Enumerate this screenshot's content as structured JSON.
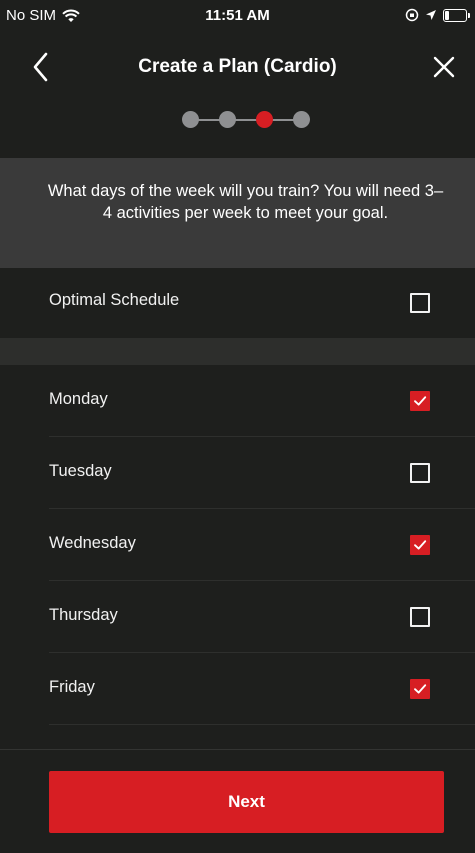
{
  "status_bar": {
    "carrier": "No SIM",
    "time": "11:51 AM"
  },
  "nav": {
    "title": "Create a Plan (Cardio)",
    "back_icon": "chevron-left-icon",
    "close_icon": "close-icon"
  },
  "stepper": {
    "total_steps": 4,
    "current_step": 3
  },
  "banner": {
    "text": "What days of the week will you train? You will need 3–4 activities per week to meet your goal."
  },
  "optimal": {
    "label": "Optimal Schedule",
    "checked": false
  },
  "days": [
    {
      "label": "Monday",
      "checked": true
    },
    {
      "label": "Tuesday",
      "checked": false
    },
    {
      "label": "Wednesday",
      "checked": true
    },
    {
      "label": "Thursday",
      "checked": false
    },
    {
      "label": "Friday",
      "checked": true
    }
  ],
  "footer": {
    "next_label": "Next"
  },
  "colors": {
    "accent": "#d71e23",
    "background": "#1e1f1d",
    "banner": "#3a3a3a"
  }
}
